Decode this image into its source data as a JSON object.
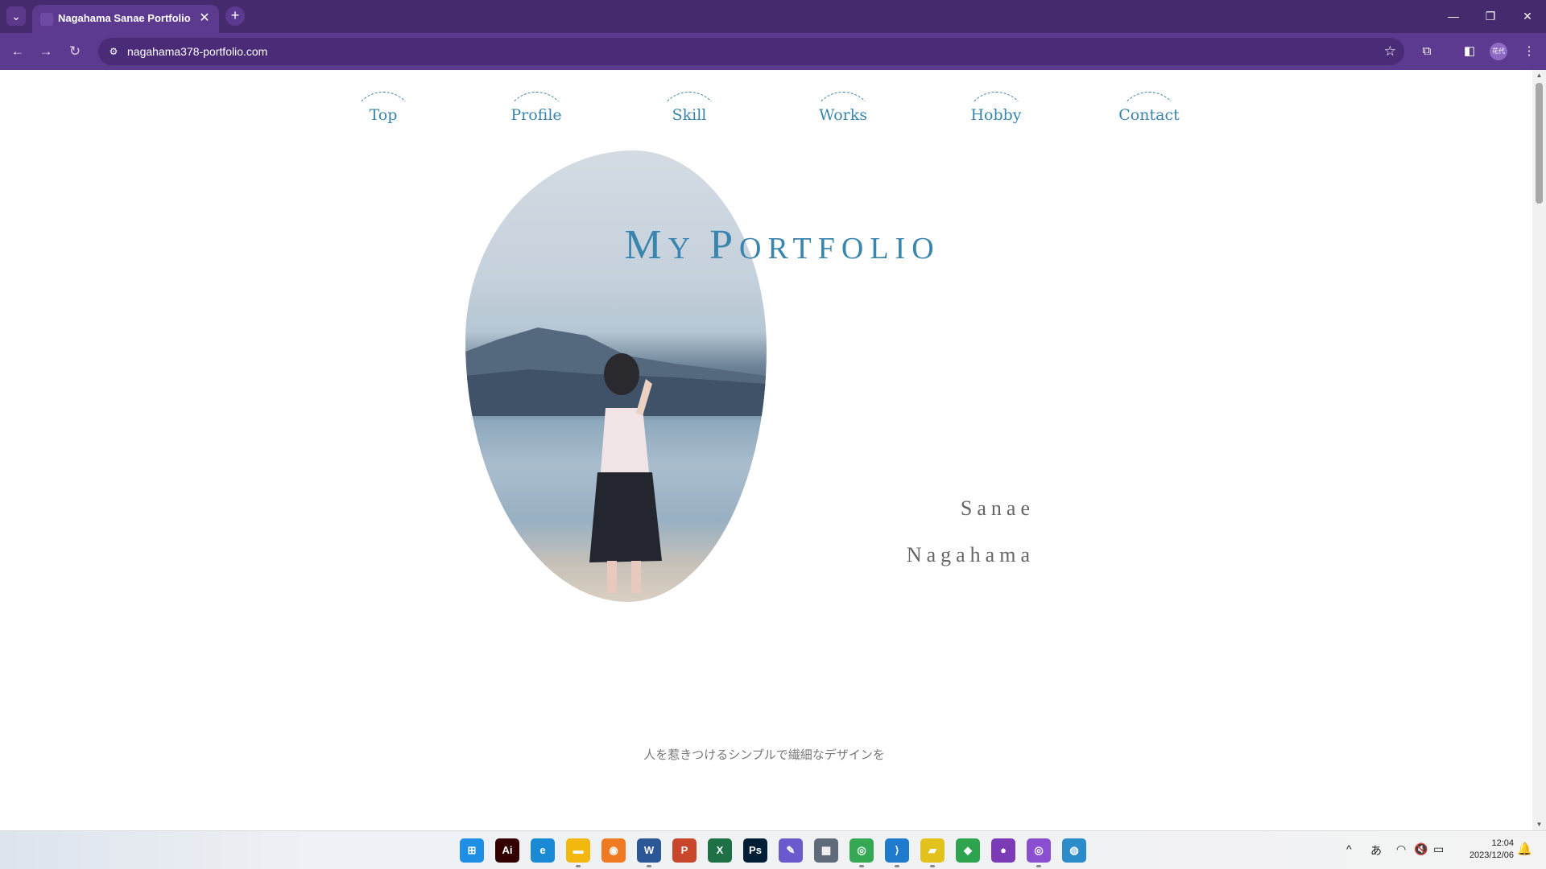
{
  "browser": {
    "tab_title": "Nagahama Sanae Portfolio",
    "tab_close": "✕",
    "new_tab": "+",
    "tab_dropdown": "⌄",
    "url": "nagahama378-portfolio.com",
    "window_buttons": [
      "—",
      "❐",
      "✕"
    ],
    "profile_label": "花代"
  },
  "site": {
    "nav": [
      "Top",
      "Profile",
      "Skill",
      "Works",
      "Hobby",
      "Contact"
    ],
    "title_parts": [
      {
        "text": "M",
        "style": "cap"
      },
      {
        "text": "Y ",
        "style": "sm"
      },
      {
        "text": "P",
        "style": "cap"
      },
      {
        "text": "ORTFOLIO",
        "style": "sm"
      }
    ],
    "name_first": "Sanae",
    "name_last": "Nagahama",
    "tagline": "人を惹きつけるシンプルで繊細なデザインを"
  },
  "taskbar": {
    "apps": [
      {
        "name": "windows-start",
        "glyph": "⊞",
        "color": "#1f8fe5"
      },
      {
        "name": "illustrator",
        "glyph": "Ai",
        "color": "#330000"
      },
      {
        "name": "edge",
        "glyph": "e",
        "color": "#1a8ad4"
      },
      {
        "name": "file-explorer",
        "glyph": "▬",
        "color": "#f2b80d"
      },
      {
        "name": "firefox",
        "glyph": "◉",
        "color": "#f07a22"
      },
      {
        "name": "word",
        "glyph": "W",
        "color": "#2b5797"
      },
      {
        "name": "powerpoint",
        "glyph": "P",
        "color": "#c8462b"
      },
      {
        "name": "excel",
        "glyph": "X",
        "color": "#1e7145"
      },
      {
        "name": "photoshop",
        "glyph": "Ps",
        "color": "#001e36"
      },
      {
        "name": "paint-tool",
        "glyph": "✎",
        "color": "#6a5acd"
      },
      {
        "name": "calculator",
        "glyph": "▦",
        "color": "#5f6b7a"
      },
      {
        "name": "chrome",
        "glyph": "◎",
        "color": "#34a853"
      },
      {
        "name": "vscode",
        "glyph": "⟩",
        "color": "#1f7acc"
      },
      {
        "name": "sticky-notes",
        "glyph": "▰",
        "color": "#e3c21c"
      },
      {
        "name": "git-app",
        "glyph": "◆",
        "color": "#2ea44f"
      },
      {
        "name": "github-desktop",
        "glyph": "●",
        "color": "#7b3bb6"
      },
      {
        "name": "chrome-profile",
        "glyph": "◎",
        "color": "#8a4fd1"
      },
      {
        "name": "globe-app",
        "glyph": "◍",
        "color": "#2b8cc9"
      }
    ],
    "tray": {
      "chevron": "^",
      "ime": "あ",
      "wifi": "◠",
      "volume": "🔇",
      "battery": "▭"
    },
    "time": "12:04",
    "date": "2023/12/06"
  }
}
